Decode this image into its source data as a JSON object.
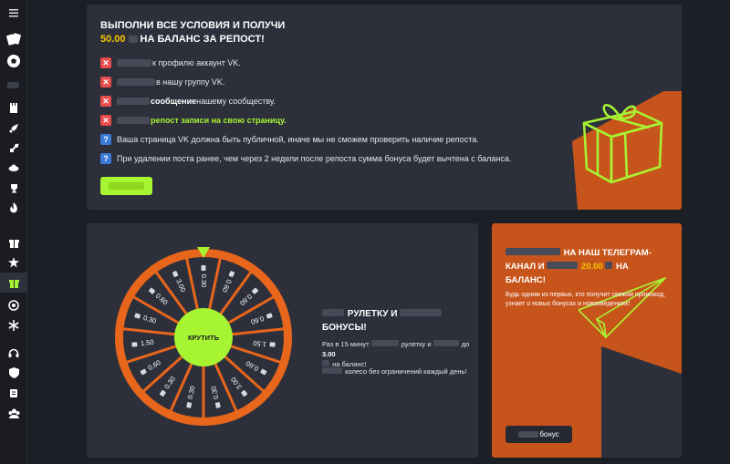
{
  "sidebar": {
    "menu_icon": "menu-icon",
    "icons": [
      "cards-icon",
      "soccer-ball-icon",
      "tower-icon",
      "rocket-icon",
      "sword-icon",
      "ufo-icon",
      "trophy-icon",
      "fire-icon",
      "gift-icon",
      "star-icon",
      "gift-active-icon",
      "sparkle-icon",
      "snowflake-icon",
      "headset-icon",
      "shield-icon",
      "scroll-icon",
      "group-icon"
    ],
    "accent": "#a7f432"
  },
  "repost": {
    "title_line1": "ВЫПОЛНИ ВСЕ УСЛОВИЯ И ПОЛУЧИ",
    "amount": "50.00",
    "title_line2": "НА БАЛАНС ЗА РЕПОСТ!",
    "conditions": [
      {
        "type": "x",
        "text": "к профилю аккаунт VK."
      },
      {
        "type": "x",
        "text": "в нашу группу VK."
      },
      {
        "type": "x",
        "text_bold": "сообщение",
        "text": " нашему сообществу."
      },
      {
        "type": "x",
        "text": "репост записи на свою страницу."
      },
      {
        "type": "q",
        "text": "Ваша страница VK должна быть публичной, иначе мы не сможем проверить наличие репоста."
      },
      {
        "type": "q",
        "text": "При удалении поста ранее, чем через 2 недели после репоста сумма бонуса будет вычтена с баланса."
      }
    ]
  },
  "wheel": {
    "spin_label": "КРУТИТЬ",
    "segments": [
      "0.30",
      "0.60",
      "0.60",
      "0.60",
      "1.50",
      "0.60",
      "3.00",
      "0.30",
      "0.30",
      "0.30",
      "0.60",
      "1.50",
      "0.30",
      "0.60",
      "3.00"
    ],
    "title_part1": "РУЛЕТКУ И",
    "title_part2": "БОНУСЫ!",
    "text1_a": "Раз в 15 минут",
    "text1_b": "рулетку и",
    "text1_c": "до",
    "text1_amount": "3.00",
    "text1_d": "на баланс!",
    "text2": "колесо без ограничений каждый день!",
    "colors": {
      "ring": "#e8661c",
      "hub": "#a7f432",
      "bg": "#2d303b"
    }
  },
  "telegram": {
    "title_a": "НА НАШ ТЕЛЕГРАМ-",
    "title_b": "КАНАЛ И",
    "amount": "20.00",
    "title_c": "НА",
    "title_d": "БАЛАНС!",
    "text": "Будь одним из первых, кто получит свежий промокод, узнает о новых бонусах и нововведениях!",
    "button_label": "бонус",
    "bg": "#c7551b"
  }
}
